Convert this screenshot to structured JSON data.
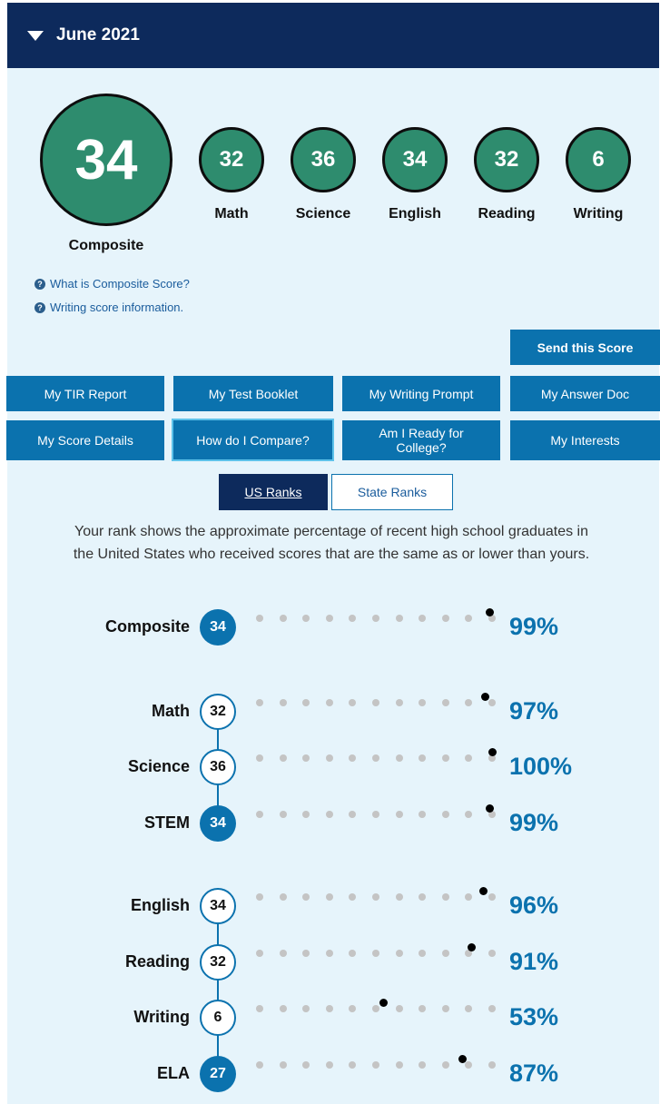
{
  "header": {
    "title": "June 2021"
  },
  "scores": {
    "composite": {
      "value": "34",
      "label": "Composite"
    },
    "subjects": [
      {
        "value": "32",
        "label": "Math"
      },
      {
        "value": "36",
        "label": "Science"
      },
      {
        "value": "34",
        "label": "English"
      },
      {
        "value": "32",
        "label": "Reading"
      },
      {
        "value": "6",
        "label": "Writing"
      }
    ]
  },
  "links": {
    "composite_info": "What is Composite Score?",
    "writing_info": "Writing score information."
  },
  "actions": {
    "send_score": "Send this Score",
    "buttons": [
      "My TIR Report",
      "My Test Booklet",
      "My Writing Prompt",
      "My Answer Doc",
      "My Score Details",
      "How do I Compare?",
      "Am I Ready for College?",
      "My Interests"
    ]
  },
  "tabs": {
    "us": "US Ranks",
    "state": "State Ranks"
  },
  "description": "Your rank shows the approximate percentage of recent high school graduates in the United States who received scores that are the same as or lower than yours.",
  "ranks": [
    {
      "label": "Composite",
      "score": "34",
      "percent_text": "99%",
      "percentile": 99,
      "filled": true
    },
    {
      "label": "Math",
      "score": "32",
      "percent_text": "97%",
      "percentile": 97,
      "filled": false
    },
    {
      "label": "Science",
      "score": "36",
      "percent_text": "100%",
      "percentile": 100,
      "filled": false
    },
    {
      "label": "STEM",
      "score": "34",
      "percent_text": "99%",
      "percentile": 99,
      "filled": true
    },
    {
      "label": "English",
      "score": "34",
      "percent_text": "96%",
      "percentile": 96,
      "filled": false
    },
    {
      "label": "Reading",
      "score": "32",
      "percent_text": "91%",
      "percentile": 91,
      "filled": false
    },
    {
      "label": "Writing",
      "score": "6",
      "percent_text": "53%",
      "percentile": 53,
      "filled": false
    },
    {
      "label": "ELA",
      "score": "27",
      "percent_text": "87%",
      "percentile": 87,
      "filled": true
    }
  ],
  "colors": {
    "header_bg": "#0d2a5c",
    "panel_bg": "#e6f4fb",
    "score_green": "#2e8c6e",
    "button_blue": "#0b72ae",
    "accent_blue": "#0b72ae"
  }
}
